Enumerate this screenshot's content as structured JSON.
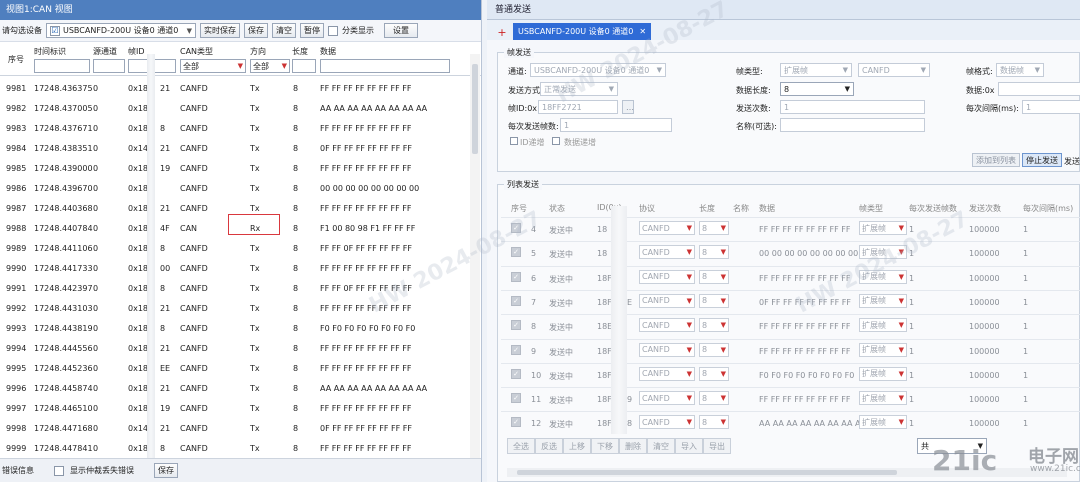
{
  "left": {
    "title": "视图1:CAN 视图",
    "toolbar": {
      "select_device_label": "请勾选设备",
      "device_check": "☑",
      "device_value": "USBCANFD-200U 设备0 通道0",
      "btn_realtime_save": "实时保存",
      "btn_save": "保存",
      "btn_clear": "清空",
      "btn_pause": "暂停",
      "classify_label": "分类显示",
      "btn_settings": "设置"
    },
    "headers": [
      "序号",
      "时间标识",
      "源通道",
      "帧ID",
      "CAN类型",
      "方向",
      "长度",
      "数据"
    ],
    "filters": {
      "can_type": "全部",
      "direction": "全部"
    },
    "rows": [
      {
        "seq": "9981",
        "time": "17248.436375",
        "src": "0",
        "id": "0x18E",
        "id_tail": "21",
        "type": "CANFD",
        "dir": "Tx",
        "len": "8",
        "data": "FF FF FF FF FF FF FF FF"
      },
      {
        "seq": "9982",
        "time": "17248.437005",
        "src": "0",
        "id": "0x18F",
        "id_tail": "",
        "type": "CANFD",
        "dir": "Tx",
        "len": "8",
        "data": "AA AA AA AA AA AA AA AA"
      },
      {
        "seq": "9983",
        "time": "17248.437671",
        "src": "0",
        "id": "0x18F",
        "id_tail": "8",
        "type": "CANFD",
        "dir": "Tx",
        "len": "8",
        "data": "FF FF FF FF FF FF FF FF"
      },
      {
        "seq": "9984",
        "time": "17248.438351",
        "src": "0",
        "id": "0x14F",
        "id_tail": "21",
        "type": "CANFD",
        "dir": "Tx",
        "len": "8",
        "data": "0F FF FF FF FF FF FF FF"
      },
      {
        "seq": "9985",
        "time": "17248.439000",
        "src": "0",
        "id": "0x18F",
        "id_tail": "19",
        "type": "CANFD",
        "dir": "Tx",
        "len": "8",
        "data": "FF FF FF FF FF FF FF FF"
      },
      {
        "seq": "9986",
        "time": "17248.439670",
        "src": "0",
        "id": "0x18F",
        "id_tail": "",
        "type": "CANFD",
        "dir": "Tx",
        "len": "8",
        "data": "00 00 00 00 00 00 00 00"
      },
      {
        "seq": "9987",
        "time": "17248.440368",
        "src": "0",
        "id": "0x18E",
        "id_tail": "21",
        "type": "CANFD",
        "dir": "Tx",
        "len": "8",
        "data": "FF FF FF FF FF FF FF FF"
      },
      {
        "seq": "9988",
        "time": "17248.440784",
        "src": "0",
        "id": "0x18F",
        "id_tail": "4F",
        "type": "CAN",
        "dir": "Rx",
        "len": "8",
        "data": "F1 00 80 98 F1 FF FF FF"
      },
      {
        "seq": "9989",
        "time": "17248.441106",
        "src": "0",
        "id": "0x18F",
        "id_tail": "8",
        "type": "CANFD",
        "dir": "Tx",
        "len": "8",
        "data": "FF FF 0F FF FF FF FF FF"
      },
      {
        "seq": "9990",
        "time": "17248.441733",
        "src": "0",
        "id": "0x18F",
        "id_tail": "00",
        "type": "CANFD",
        "dir": "Tx",
        "len": "8",
        "data": "FF FF FF FF FF FF FF FF"
      },
      {
        "seq": "9991",
        "time": "17248.442397",
        "src": "0",
        "id": "0x18F",
        "id_tail": "8",
        "type": "CANFD",
        "dir": "Tx",
        "len": "8",
        "data": "FF FF 0F FF FF FF FF FF"
      },
      {
        "seq": "9992",
        "time": "17248.443103",
        "src": "0",
        "id": "0x18E",
        "id_tail": "21",
        "type": "CANFD",
        "dir": "Tx",
        "len": "8",
        "data": "FF FF FF FF FF FF FF FF"
      },
      {
        "seq": "9993",
        "time": "17248.443819",
        "src": "0",
        "id": "0x18F",
        "id_tail": "8",
        "type": "CANFD",
        "dir": "Tx",
        "len": "8",
        "data": "F0 F0 F0 F0 F0 F0 F0 F0"
      },
      {
        "seq": "9994",
        "time": "17248.444556",
        "src": "0",
        "id": "0x18E",
        "id_tail": "21",
        "type": "CANFD",
        "dir": "Tx",
        "len": "8",
        "data": "FF FF FF FF FF FF FF FF"
      },
      {
        "seq": "9995",
        "time": "17248.445236",
        "src": "0",
        "id": "0x18F",
        "id_tail": "EE",
        "type": "CANFD",
        "dir": "Tx",
        "len": "8",
        "data": "FF FF FF FF FF FF FF FF"
      },
      {
        "seq": "9996",
        "time": "17248.445874",
        "src": "0",
        "id": "0x18E",
        "id_tail": "21",
        "type": "CANFD",
        "dir": "Tx",
        "len": "8",
        "data": "AA AA AA AA AA AA AA AA"
      },
      {
        "seq": "9997",
        "time": "17248.446510",
        "src": "0",
        "id": "0x18F",
        "id_tail": "19",
        "type": "CANFD",
        "dir": "Tx",
        "len": "8",
        "data": "FF FF FF FF FF FF FF FF"
      },
      {
        "seq": "9998",
        "time": "17248.447168",
        "src": "0",
        "id": "0x14F",
        "id_tail": "21",
        "type": "CANFD",
        "dir": "Tx",
        "len": "8",
        "data": "0F FF FF FF FF FF FF FF"
      },
      {
        "seq": "9999",
        "time": "17248.447841",
        "src": "0",
        "id": "0x18F",
        "id_tail": "8",
        "type": "CANFD",
        "dir": "Tx",
        "len": "8",
        "data": "FF FF FF FF FF FF FF FF"
      }
    ],
    "bottom": {
      "error_label": "错误信息",
      "show_drop_label": "显示仲裁丢失错误",
      "btn_save": "保存"
    }
  },
  "right": {
    "title": "普通发送",
    "tab_label": "USBCANFD-200U 设备0 通道0",
    "frame_send": {
      "group_label": "帧发送",
      "channel_label": "通道:",
      "channel_value": "USBCANFD-200U 设备0 通道0",
      "frame_type_label": "帧类型:",
      "frame_type_value": "扩展帧",
      "protocol_value": "CANFD",
      "frame_format_label": "帧格式:",
      "frame_format_value": "数据帧",
      "send_mode_label": "发送方式:",
      "send_mode_value": "正常发送",
      "data_len_label": "数据长度:",
      "data_len_value": "8",
      "data_label": "数据:0x",
      "frame_id_label": "帧ID:0x",
      "frame_id_value": "18FF2721",
      "send_count_label": "发送次数:",
      "send_count_value": "1",
      "interval_label": "每次间隔(ms):",
      "interval_value": "1",
      "per_send_label": "每次发送帧数:",
      "per_send_value": "1",
      "name_label": "名称(可选):",
      "id_inc_label": "ID递增",
      "data_inc_label": "数据递增",
      "btn_add_list": "添加到列表",
      "btn_stop": "停止发送",
      "btn_send": "发送"
    },
    "list_send": {
      "group_label": "列表发送",
      "headers": [
        "序号",
        "状态",
        "ID(0x)",
        "协议",
        "长度",
        "名称",
        "数据",
        "帧类型",
        "每次发送帧数",
        "发送次数",
        "每次间隔(ms)"
      ],
      "rows": [
        {
          "seq": "4",
          "status": "发送中",
          "id": "18",
          "id_tail": "",
          "proto": "CANFD",
          "len": "8",
          "data": "FF FF FF FF FF FF FF FF",
          "ftype": "扩展帧",
          "per": "1",
          "count": "100000",
          "interval": "1"
        },
        {
          "seq": "5",
          "status": "发送中",
          "id": "18",
          "id_tail": "",
          "proto": "CANFD",
          "len": "8",
          "data": "00 00 00 00 00 00 00 00",
          "ftype": "扩展帧",
          "per": "1",
          "count": "100000",
          "interval": "1"
        },
        {
          "seq": "6",
          "status": "发送中",
          "id": "18F",
          "id_tail": "",
          "proto": "CANFD",
          "len": "8",
          "data": "FF FF FF FF FF FF FF FF",
          "ftype": "扩展帧",
          "per": "1",
          "count": "100000",
          "interval": "1"
        },
        {
          "seq": "7",
          "status": "发送中",
          "id": "18F",
          "id_tail": "E",
          "proto": "CANFD",
          "len": "8",
          "data": "0F FF FF FF FF FF FF FF",
          "ftype": "扩展帧",
          "per": "1",
          "count": "100000",
          "interval": "1"
        },
        {
          "seq": "8",
          "status": "发送中",
          "id": "18E",
          "id_tail": "",
          "proto": "CANFD",
          "len": "8",
          "data": "FF FF FF FF FF FF FF FF",
          "ftype": "扩展帧",
          "per": "1",
          "count": "100000",
          "interval": "1"
        },
        {
          "seq": "9",
          "status": "发送中",
          "id": "18F",
          "id_tail": "",
          "proto": "CANFD",
          "len": "8",
          "data": "FF FF FF FF FF FF FF FF",
          "ftype": "扩展帧",
          "per": "1",
          "count": "100000",
          "interval": "1"
        },
        {
          "seq": "10",
          "status": "发送中",
          "id": "18F",
          "id_tail": "",
          "proto": "CANFD",
          "len": "8",
          "data": "F0 F0 F0 F0 F0 F0 F0 F0",
          "ftype": "扩展帧",
          "per": "1",
          "count": "100000",
          "interval": "1"
        },
        {
          "seq": "11",
          "status": "发送中",
          "id": "18F",
          "id_tail": "9",
          "proto": "CANFD",
          "len": "8",
          "data": "FF FF FF FF FF FF FF FF",
          "ftype": "扩展帧",
          "per": "1",
          "count": "100000",
          "interval": "1"
        },
        {
          "seq": "12",
          "status": "发送中",
          "id": "18F",
          "id_tail": "8",
          "proto": "CANFD",
          "len": "8",
          "data": "AA AA AA AA AA AA AA AA",
          "ftype": "扩展帧",
          "per": "1",
          "count": "100000",
          "interval": "1"
        }
      ],
      "buttons": [
        "全选",
        "反选",
        "上移",
        "下移",
        "删除",
        "清空",
        "导入",
        "导出"
      ],
      "combo_prefix": "共"
    },
    "watermark": "HW 2024-08-27"
  },
  "logo": {
    "big": "21ic",
    "small": "电子网",
    "domain": "www.21ic.com"
  },
  "colors": {
    "title_blue": "#4f7fbf",
    "tab_blue": "#2f6bd6",
    "rx_highlight": "#d9383e"
  }
}
